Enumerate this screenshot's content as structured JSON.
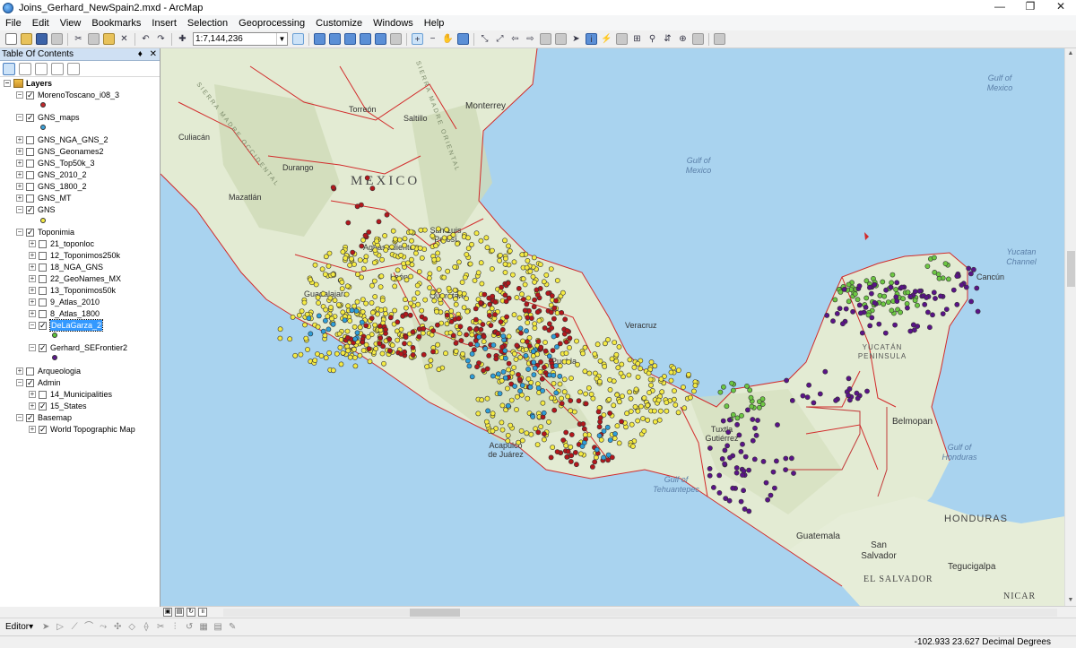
{
  "window": {
    "title": "Joins_Gerhard_NewSpain2.mxd - ArcMap",
    "minimize": "—",
    "maximize": "❐",
    "close": "✕"
  },
  "menu": [
    "File",
    "Edit",
    "View",
    "Bookmarks",
    "Insert",
    "Selection",
    "Geoprocessing",
    "Customize",
    "Windows",
    "Help"
  ],
  "toolbar": {
    "scale": "1:7,144,236"
  },
  "toc": {
    "title": "Table Of Contents",
    "pin": "♦",
    "close": "✕",
    "root": "Layers",
    "layers": [
      {
        "name": "MorenoToscano_i08_3",
        "checked": true,
        "expander": "−",
        "symbol": "#c0282c"
      },
      {
        "name": "GNS_maps",
        "checked": true,
        "expander": "−",
        "symbol": "#3aa0d8"
      },
      {
        "name": "GNS_NGA_GNS_2",
        "checked": false,
        "expander": "+"
      },
      {
        "name": "GNS_Geonames2",
        "checked": false,
        "expander": "+"
      },
      {
        "name": "GNS_Top50k_3",
        "checked": false,
        "expander": "+"
      },
      {
        "name": "GNS_2010_2",
        "checked": false,
        "expander": "+"
      },
      {
        "name": "GNS_1800_2",
        "checked": false,
        "expander": "+"
      },
      {
        "name": "GNS_MT",
        "checked": false,
        "expander": "+"
      },
      {
        "name": "GNS",
        "checked": true,
        "expander": "−",
        "symbol": "#f4ea44"
      }
    ],
    "toponimia": {
      "name": "Toponimia",
      "checked": true,
      "children": [
        {
          "name": "21_toponloc",
          "checked": false
        },
        {
          "name": "12_Toponimos250k",
          "checked": false
        },
        {
          "name": "18_NGA_GNS",
          "checked": false
        },
        {
          "name": "22_GeoNames_MX",
          "checked": false
        },
        {
          "name": "13_Toponimos50k",
          "checked": false
        },
        {
          "name": "9_Atlas_2010",
          "checked": false
        },
        {
          "name": "8_Atlas_1800",
          "checked": false
        },
        {
          "name": "DeLaGarza_2",
          "checked": true,
          "selected": true,
          "symbol": "#5ec43a"
        },
        {
          "name": "Gerhard_SEFrontier2",
          "checked": true,
          "symbol": "#5b1a8c"
        }
      ]
    },
    "groups": [
      {
        "name": "Arqueologia",
        "checked": false,
        "expander": "+"
      },
      {
        "name": "Admin",
        "checked": true,
        "expander": "−",
        "children": [
          {
            "name": "14_Municipalities",
            "checked": false,
            "expander": "+"
          },
          {
            "name": "15_States",
            "checked": true,
            "expander": "+"
          }
        ]
      },
      {
        "name": "Basemap",
        "checked": true,
        "expander": "−",
        "children": [
          {
            "name": "World Topographic Map",
            "checked": true,
            "expander": "+"
          }
        ]
      }
    ]
  },
  "map": {
    "labels": {
      "mexico": "MEXICO",
      "gulf_mexico": "Gulf of\nMexico",
      "gulf_mexico_ne": "Gulf of\nMexico",
      "yucatan_channel": "Yucatan\nChannel",
      "cancun": "Cancún",
      "monterrey": "Monterrey",
      "torreon": "Torreón",
      "saltillo": "Saltillo",
      "culiacan": "Culiacán",
      "durango": "Durango",
      "mazatlan": "Mazatlán",
      "san_luis": "San Luis\nPotosí",
      "aguascalientes": "Aguascalientes",
      "leon": "León",
      "guadalajara": "Guadalajara",
      "queretaro": "Querétaro",
      "puebla": "Puebla",
      "veracruz": "Veracruz",
      "acapulco": "Acapulco\nde Juárez",
      "gulf_tehuantepec": "Gulf of\nTehuantepec",
      "tuxtla": "Tuxtla\nGutiérrez",
      "yucatan_peninsula": "YUCATÁN\nPENINSULA",
      "belmopan": "Belmopan",
      "gulf_honduras": "Gulf of\nHonduras",
      "honduras": "HONDURAS",
      "guatemala": "Guatemala",
      "tegucigalpa": "Tegucigalpa",
      "san_salvador": "San\nSalvador",
      "el_salvador": "EL SALVADOR",
      "nicaragua": "NICAR",
      "sierra_occidental": "SIERRA MADRE OCCIDENTAL",
      "sierra_oriental": "SIERRA MADRE ORIENTAL"
    },
    "colors": {
      "ocean": "#a9d3ef",
      "land": "#e4ecd6",
      "land_highland": "#cfdcba",
      "border": "#d22b2b",
      "red": "#b3171c",
      "yellow": "#f4ea44",
      "blue": "#2f9ed8",
      "green": "#6cc742",
      "purple": "#5a1388"
    }
  },
  "editor": {
    "label": "Editor▾"
  },
  "status": {
    "coordinates": "-102.933  23.627 Decimal Degrees"
  }
}
